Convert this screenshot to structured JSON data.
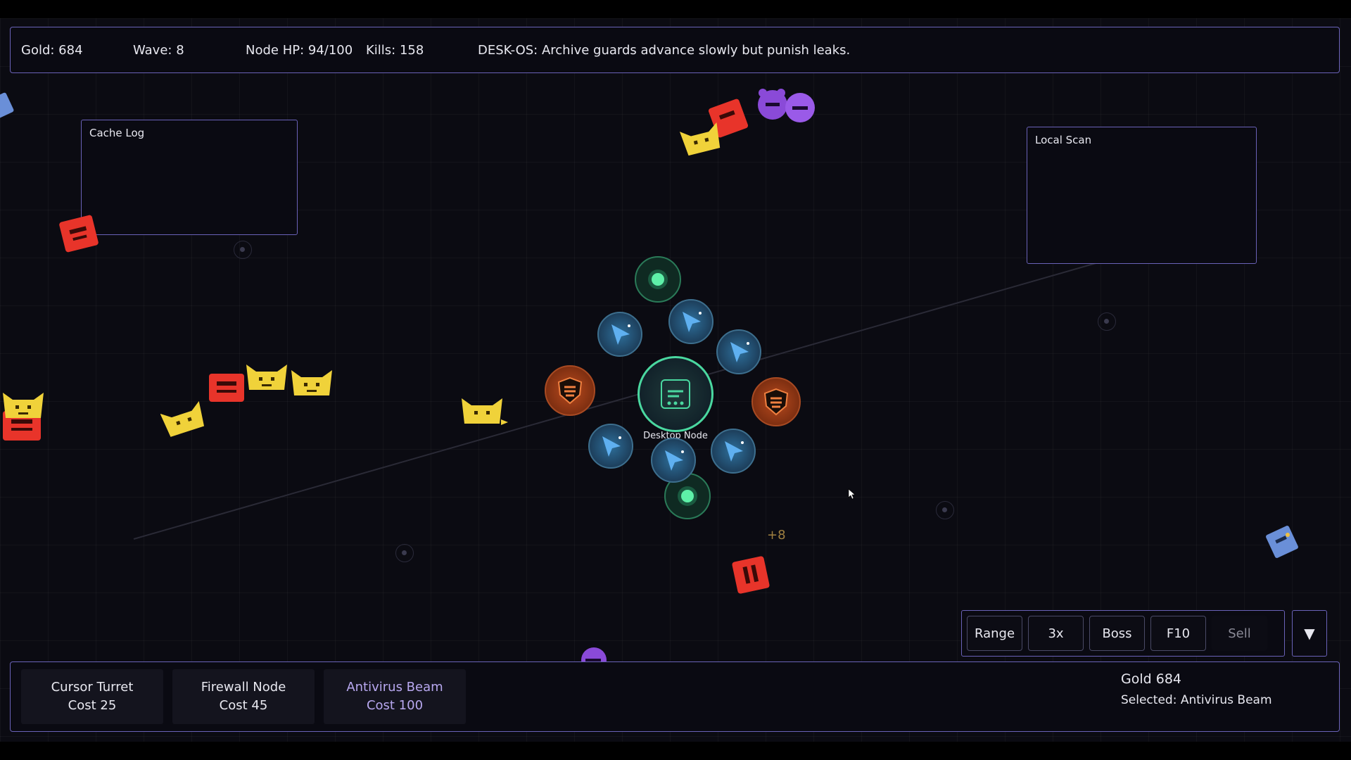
{
  "hud": {
    "gold": "Gold: 684",
    "wave": "Wave: 8",
    "node_hp": "Node HP: 94/100",
    "kills": "Kills: 158",
    "message": "DESK-OS: Archive guards advance slowly but punish leaks."
  },
  "panels": {
    "cache_log": "Cache Log",
    "local_scan": "Local Scan"
  },
  "core": {
    "label": "Desktop Node"
  },
  "floating_text": "+8",
  "controls": {
    "range": "Range",
    "speed": "3x",
    "boss": "Boss",
    "f10": "F10",
    "sell": "Sell",
    "toggle": "▼"
  },
  "shop": [
    {
      "name": "Cursor Turret",
      "cost": "Cost 25"
    },
    {
      "name": "Firewall Node",
      "cost": "Cost 45"
    },
    {
      "name": "Antivirus Beam",
      "cost": "Cost 100"
    }
  ],
  "status": {
    "gold": "Gold 684",
    "selected": "Selected: Antivirus Beam"
  },
  "colors": {
    "accent": "#6a62b8",
    "selected_text": "#b8a8f0",
    "enemy_red": "#e8342a",
    "enemy_yellow": "#f0d23a",
    "enemy_purple": "#8a4ad8",
    "enemy_blue": "#6a8fd8",
    "core_green": "#4ad8a0"
  },
  "icons": {
    "cursor_turret": "arrow-cursor-icon",
    "firewall_node": "shield-icon",
    "antivirus_beam": "green-orb-icon",
    "desktop_node": "document-icon",
    "toggle": "chevron-down-icon"
  }
}
